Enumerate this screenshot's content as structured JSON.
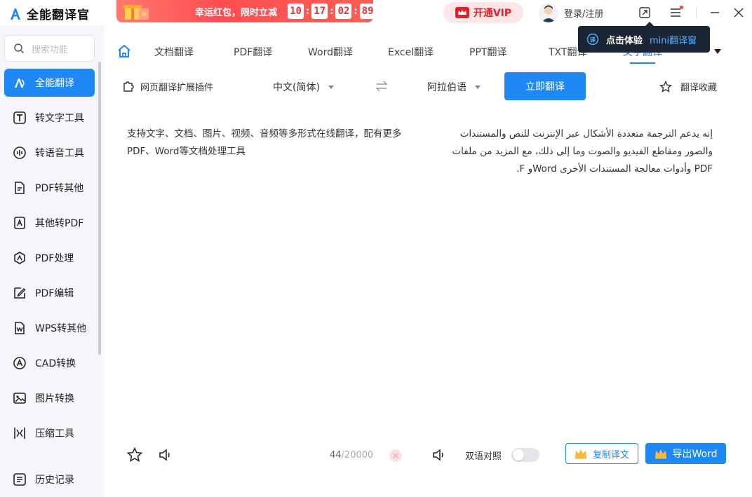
{
  "app": {
    "title": "全能翻译官"
  },
  "promo": {
    "text": "幸运红包，限时立减",
    "timer": [
      "10",
      "17",
      "02",
      "89"
    ]
  },
  "header": {
    "vip_label": "开通VIP",
    "login_label": "登录/注册"
  },
  "tooltip": {
    "prefix": "点击体验",
    "highlight": "mini翻译窗"
  },
  "sidebar": {
    "search_placeholder": "搜索功能",
    "items": [
      {
        "label": "全能翻译",
        "icon": "translate-icon",
        "active": true
      },
      {
        "label": "转文字工具",
        "icon": "text-icon"
      },
      {
        "label": "转语音工具",
        "icon": "voice-icon"
      },
      {
        "label": "PDF转其他",
        "icon": "pdf-convert-icon"
      },
      {
        "label": "其他转PDF",
        "icon": "to-pdf-icon"
      },
      {
        "label": "PDF处理",
        "icon": "pdf-process-icon"
      },
      {
        "label": "PDF编辑",
        "icon": "pdf-edit-icon"
      },
      {
        "label": "WPS转其他",
        "icon": "wps-icon"
      },
      {
        "label": "CAD转换",
        "icon": "cad-icon"
      },
      {
        "label": "图片转换",
        "icon": "image-icon"
      },
      {
        "label": "压缩工具",
        "icon": "compress-icon"
      }
    ],
    "history_label": "历史记录"
  },
  "tabs": [
    {
      "label": "文档翻译"
    },
    {
      "label": "PDF翻译"
    },
    {
      "label": "Word翻译"
    },
    {
      "label": "Excel翻译"
    },
    {
      "label": "PPT翻译"
    },
    {
      "label": "TXT翻译"
    },
    {
      "label": "文字翻译",
      "active": true
    }
  ],
  "toolbar": {
    "plugin_label": "网页翻译扩展插件",
    "source_lang": "中文(简体)",
    "target_lang": "阿拉伯语",
    "translate_label": "立即翻译",
    "favorites_label": "翻译收藏"
  },
  "content": {
    "source_text": "支持文字、文档、图片、视频、音频等多形式在线翻译，配有更多PDF、Word等文档处理工具",
    "target_text": "إنه يدعم الترجمة متعددة الأشكال عبر الإنترنت للنص والمستندات والصور ومقاطع الفيديو والصوت وما إلى ذلك، مع المزيد من ملفات PDF وأدوات معالجة المستندات الأخرى Wordو F."
  },
  "bottom": {
    "count": "44",
    "limit": "/20000",
    "bilingual_label": "双语对照",
    "copy_label": "复制译文",
    "export_label": "导出Word"
  },
  "colors": {
    "accent": "#1e88f5",
    "promo": "#ff4d52",
    "vip": "#e0202b"
  }
}
